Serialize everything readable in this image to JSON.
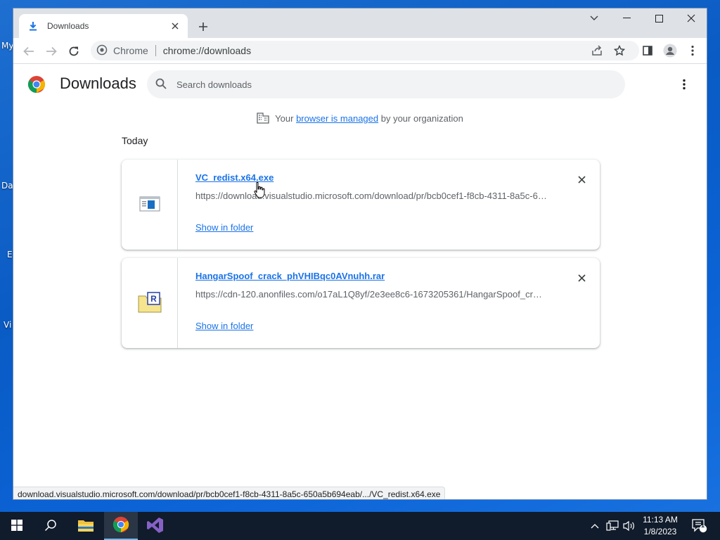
{
  "desktop": {
    "fragments": [
      "My",
      "Da",
      "E",
      "Vi"
    ]
  },
  "tab": {
    "title": "Downloads"
  },
  "omnibox": {
    "chip": "Chrome",
    "url": "chrome://downloads"
  },
  "header": {
    "title": "Downloads",
    "search_placeholder": "Search downloads"
  },
  "managed": {
    "prefix": "Your ",
    "link": "browser is managed",
    "suffix": " by your organization"
  },
  "section_label": "Today",
  "downloads": [
    {
      "name": "VC_redist.x64.exe",
      "url": "https://download.visualstudio.microsoft.com/download/pr/bcb0cef1-f8cb-4311-8a5c-650a5b694eab/VC_redist.x64.exe",
      "action": "Show in folder",
      "icon": "installer-file-icon"
    },
    {
      "name": "HangarSpoof_crack_phVHIBqc0AVnuhh.rar",
      "url": "https://cdn-120.anonfiles.com/o17aL1Q8yf/2e3ee8c6-1673205361/HangarSpoof_crack_phVHIBqc0AVnuhh.rar",
      "action": "Show in folder",
      "icon": "rar-archive-icon"
    }
  ],
  "status_url": "download.visualstudio.microsoft.com/download/pr/bcb0cef1-f8cb-4311-8a5c-650a5b694eab/.../VC_redist.x64.exe",
  "clock": {
    "time": "11:13 AM",
    "date": "1/8/2023"
  },
  "notifications": {
    "count": "1"
  },
  "colors": {
    "link": "#1a73e8",
    "taskbar": "#101b2b",
    "tabstrip": "#dee1e6"
  }
}
